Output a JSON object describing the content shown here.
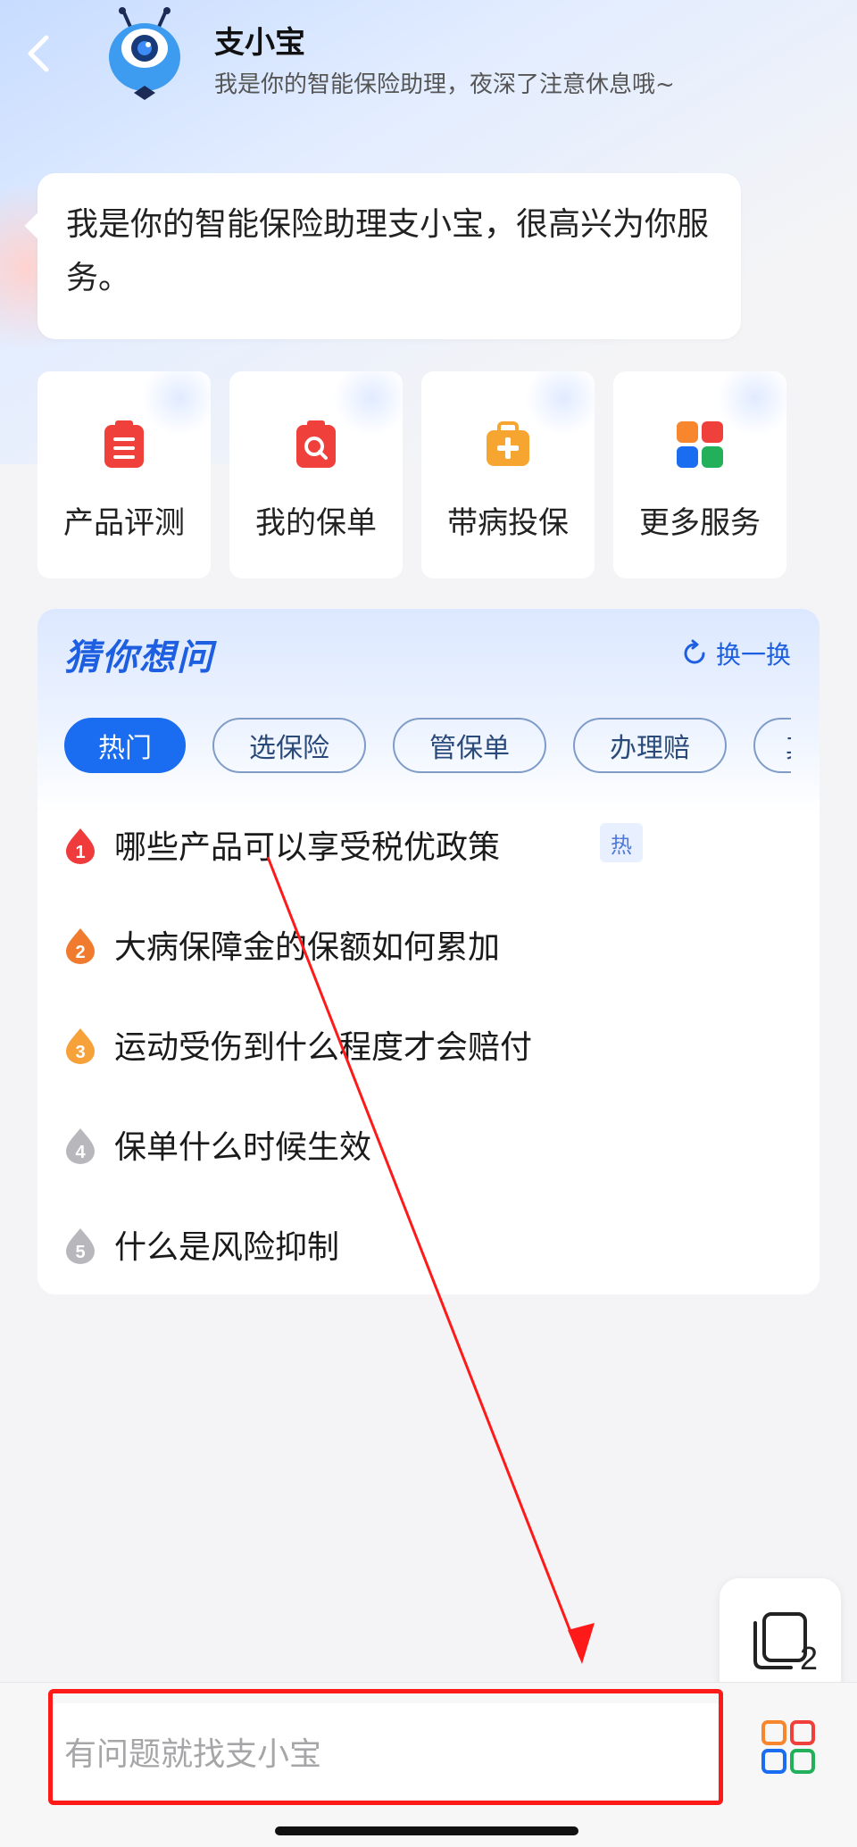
{
  "header": {
    "name": "支小宝",
    "subtitle": "我是你的智能保险助理，夜深了注意休息哦~"
  },
  "greeting": "我是你的智能保险助理支小宝，很高兴为你服务。",
  "shortcuts": [
    {
      "label": "产品评测",
      "icon": "clipboard-list-icon",
      "color": "#f0403c"
    },
    {
      "label": "我的保单",
      "icon": "policy-search-icon",
      "color": "#f0403c"
    },
    {
      "label": "带病投保",
      "icon": "medical-kit-icon",
      "color": "#f7a531"
    },
    {
      "label": "更多服务",
      "icon": "more-services-grid-icon",
      "color": "#1a6cf0"
    }
  ],
  "ask": {
    "title": "猜你想问",
    "refresh_label": "换一换",
    "tabs": [
      "热门",
      "选保险",
      "管保单",
      "办理赔",
      "其"
    ],
    "active_tab": "热门",
    "hot_tag": "热",
    "questions": [
      {
        "rank": "1",
        "text": "哪些产品可以享受税优政策",
        "rank_color": "#ef3b3b",
        "hot": true
      },
      {
        "rank": "2",
        "text": "大病保障金的保额如何累加",
        "rank_color": "#f07a2e",
        "hot": false
      },
      {
        "rank": "3",
        "text": "运动受伤到什么程度才会赔付",
        "rank_color": "#f6a13a",
        "hot": false
      },
      {
        "rank": "4",
        "text": "保单什么时候生效",
        "rank_color": "#b8b8bc",
        "hot": false
      },
      {
        "rank": "5",
        "text": "什么是风险抑制",
        "rank_color": "#b8b8bc",
        "hot": false
      }
    ]
  },
  "fab": {
    "count": "2"
  },
  "input": {
    "placeholder": "有问题就找支小宝"
  },
  "colors": {
    "accent": "#1a6cf0",
    "annotation": "#ff1a1a"
  }
}
